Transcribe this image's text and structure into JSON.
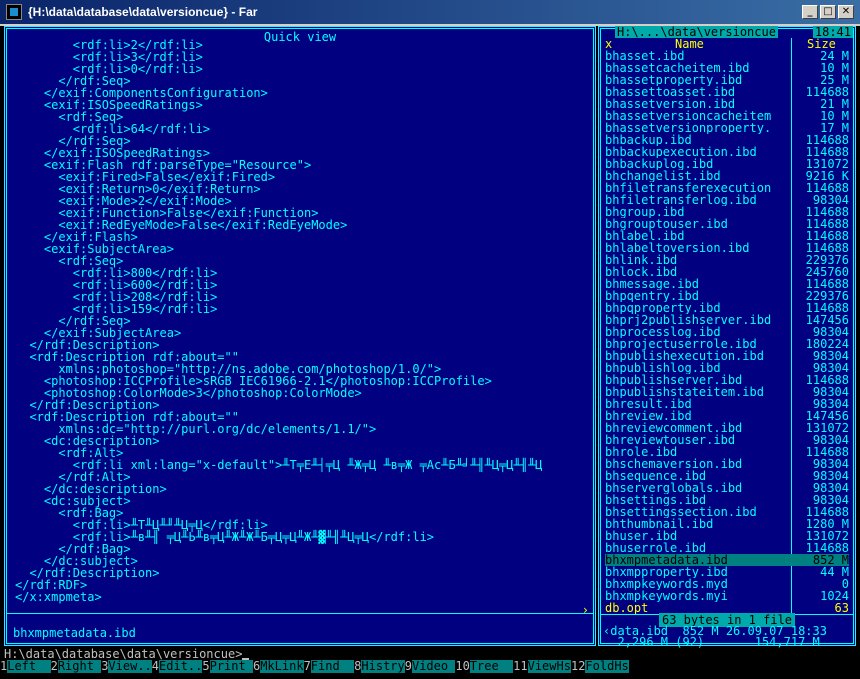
{
  "window": {
    "title": "{H:\\data\\database\\data\\versioncue} - Far",
    "minimize": "_",
    "maximize": "□",
    "close": "✕"
  },
  "quick_view": {
    "title": "Quick view",
    "lines": [
      "        <rdf:li>2</rdf:li>",
      "        <rdf:li>3</rdf:li>",
      "        <rdf:li>0</rdf:li>",
      "      </rdf:Seq>",
      "    </exif:ComponentsConfiguration>",
      "    <exif:ISOSpeedRatings>",
      "      <rdf:Seq>",
      "        <rdf:li>64</rdf:li>",
      "      </rdf:Seq>",
      "    </exif:ISOSpeedRatings>",
      "    <exif:Flash rdf:parseType=\"Resource\">",
      "      <exif:Fired>False</exif:Fired>",
      "      <exif:Return>0</exif:Return>",
      "      <exif:Mode>2</exif:Mode>",
      "      <exif:Function>False</exif:Function>",
      "      <exif:RedEyeMode>False</exif:RedEyeMode>",
      "    </exif:Flash>",
      "    <exif:SubjectArea>",
      "      <rdf:Seq>",
      "        <rdf:li>800</rdf:li>",
      "        <rdf:li>600</rdf:li>",
      "        <rdf:li>208</rdf:li>",
      "        <rdf:li>159</rdf:li>",
      "      </rdf:Seq>",
      "    </exif:SubjectArea>",
      "  </rdf:Description>",
      "  <rdf:Description rdf:about=\"\"",
      "      xmlns:photoshop=\"http://ns.adobe.com/photoshop/1.0/\">",
      "    <photoshop:ICCProfile>sRGB IEC61966-2.1</photoshop:ICCProfile>",
      "    <photoshop:ColorMode>3</photoshop:ColorMode>",
      "  </rdf:Description>",
      "  <rdf:Description rdf:about=\"\"",
      "      xmlns:dc=\"http://purl.org/dc/elements/1.1/\">",
      "    <dc:description>",
      "      <rdf:Alt>",
      "        <rdf:li xml:lang=\"x-default\">╨Т╤Е╨┤╤Ц ╨Ж╤Ц ╨в╤Ж ╤Ас╨Б╨╛╨╢╨Ц╤Ц╨╢╨Ц",
      "      </rdf:Alt>",
      "    </dc:description>",
      "    <dc:subject>",
      "      <rdf:Bag>",
      "        <rdf:li>╨Т╨Ц╨╜╨Ц╤Ц</rdf:li>",
      "        <rdf:li>╨в╨╢ ╤Ц╨Ь╨в╤Ц╨Ж╨Ж╨Б╤Ц╤Ц╨Ж╨▓╨╢╨Ц╤Ц</rdf:li>",
      "      </rdf:Bag>",
      "    </dc:subject>",
      "  </rdf:Description>",
      "</rdf:RDF>",
      "</x:xmpmeta>"
    ],
    "scroll_arrow": "›",
    "status_filename": "bhxmpmetadata.ibd"
  },
  "file_panel": {
    "path": "H:\\...\\data\\versioncue",
    "clock": "18:41",
    "col_x": "x",
    "col_name": "Name",
    "col_size": "Size",
    "files": [
      {
        "name": "bhasset.ibd",
        "size": "24 M"
      },
      {
        "name": "bhassetcacheitem.ibd",
        "size": "10 M"
      },
      {
        "name": "bhassetproperty.ibd",
        "size": "25 M"
      },
      {
        "name": "bhassettoasset.ibd",
        "size": "114688"
      },
      {
        "name": "bhassetversion.ibd",
        "size": "21 M"
      },
      {
        "name": "bhassetversioncacheitem",
        "size": "10 M"
      },
      {
        "name": "bhassetversionproperty.",
        "size": "17 M"
      },
      {
        "name": "bhbackup.ibd",
        "size": "114688"
      },
      {
        "name": "bhbackupexecution.ibd",
        "size": "114688"
      },
      {
        "name": "bhbackuplog.ibd",
        "size": "131072"
      },
      {
        "name": "bhchangelist.ibd",
        "size": "9216 K"
      },
      {
        "name": "bhfiletransferexecution",
        "size": "114688"
      },
      {
        "name": "bhfiletransferlog.ibd",
        "size": "98304"
      },
      {
        "name": "bhgroup.ibd",
        "size": "114688"
      },
      {
        "name": "bhgrouptouser.ibd",
        "size": "114688"
      },
      {
        "name": "bhlabel.ibd",
        "size": "114688"
      },
      {
        "name": "bhlabeltoversion.ibd",
        "size": "114688"
      },
      {
        "name": "bhlink.ibd",
        "size": "229376"
      },
      {
        "name": "bhlock.ibd",
        "size": "245760"
      },
      {
        "name": "bhmessage.ibd",
        "size": "114688"
      },
      {
        "name": "bhpqentry.ibd",
        "size": "229376"
      },
      {
        "name": "bhpqproperty.ibd",
        "size": "114688"
      },
      {
        "name": "bhprj2publishserver.ibd",
        "size": "147456"
      },
      {
        "name": "bhprocesslog.ibd",
        "size": "98304"
      },
      {
        "name": "bhprojectuserrole.ibd",
        "size": "180224"
      },
      {
        "name": "bhpublishexecution.ibd",
        "size": "98304"
      },
      {
        "name": "bhpublishlog.ibd",
        "size": "98304"
      },
      {
        "name": "bhpublishserver.ibd",
        "size": "114688"
      },
      {
        "name": "bhpublishstateitem.ibd",
        "size": "98304"
      },
      {
        "name": "bhresult.ibd",
        "size": "98304"
      },
      {
        "name": "bhreview.ibd",
        "size": "147456"
      },
      {
        "name": "bhreviewcomment.ibd",
        "size": "131072"
      },
      {
        "name": "bhreviewtouser.ibd",
        "size": "98304"
      },
      {
        "name": "bhrole.ibd",
        "size": "114688"
      },
      {
        "name": "bhschemaversion.ibd",
        "size": "98304"
      },
      {
        "name": "bhsequence.ibd",
        "size": "98304"
      },
      {
        "name": "bhserverglobals.ibd",
        "size": "98304"
      },
      {
        "name": "bhsettings.ibd",
        "size": "98304"
      },
      {
        "name": "bhsettingssection.ibd",
        "size": "114688"
      },
      {
        "name": "bhthumbnail.ibd",
        "size": "1280 M"
      },
      {
        "name": "bhuser.ibd",
        "size": "131072"
      },
      {
        "name": "bhuserrole.ibd",
        "size": "114688"
      },
      {
        "name": "bhxmpmetadata.ibd",
        "size": "852 M"
      },
      {
        "name": "bhxmpproperty.ibd",
        "size": "44 M"
      },
      {
        "name": "bhxmpkeywords.myd",
        "size": "0"
      },
      {
        "name": "bhxmpkeywords.myi",
        "size": "1024"
      },
      {
        "name": "db.opt",
        "size": "63"
      }
    ],
    "selected_file": "bhxmpmetadata.ibd",
    "highlighted_file": "db.opt",
    "selection_info": "63 bytes in 1 file",
    "info_line1": "‹data.ibd  852 M 26.09.07 18:33",
    "info_line2": "  2,296 M (92)       154,717 M"
  },
  "command_line": {
    "prompt": "H:\\data\\database\\data\\versioncue>"
  },
  "keybar": [
    {
      "num": "1",
      "label": "Left  "
    },
    {
      "num": "2",
      "label": "Right "
    },
    {
      "num": "3",
      "label": "View.."
    },
    {
      "num": "4",
      "label": "Edit.."
    },
    {
      "num": "5",
      "label": "Print "
    },
    {
      "num": "6",
      "label": "MkLink"
    },
    {
      "num": "7",
      "label": "Find  "
    },
    {
      "num": "8",
      "label": "Histry"
    },
    {
      "num": "9",
      "label": "Video "
    },
    {
      "num": "10",
      "label": "Tree  "
    },
    {
      "num": "11",
      "label": "ViewHs"
    },
    {
      "num": "12",
      "label": "FoldHs"
    }
  ]
}
